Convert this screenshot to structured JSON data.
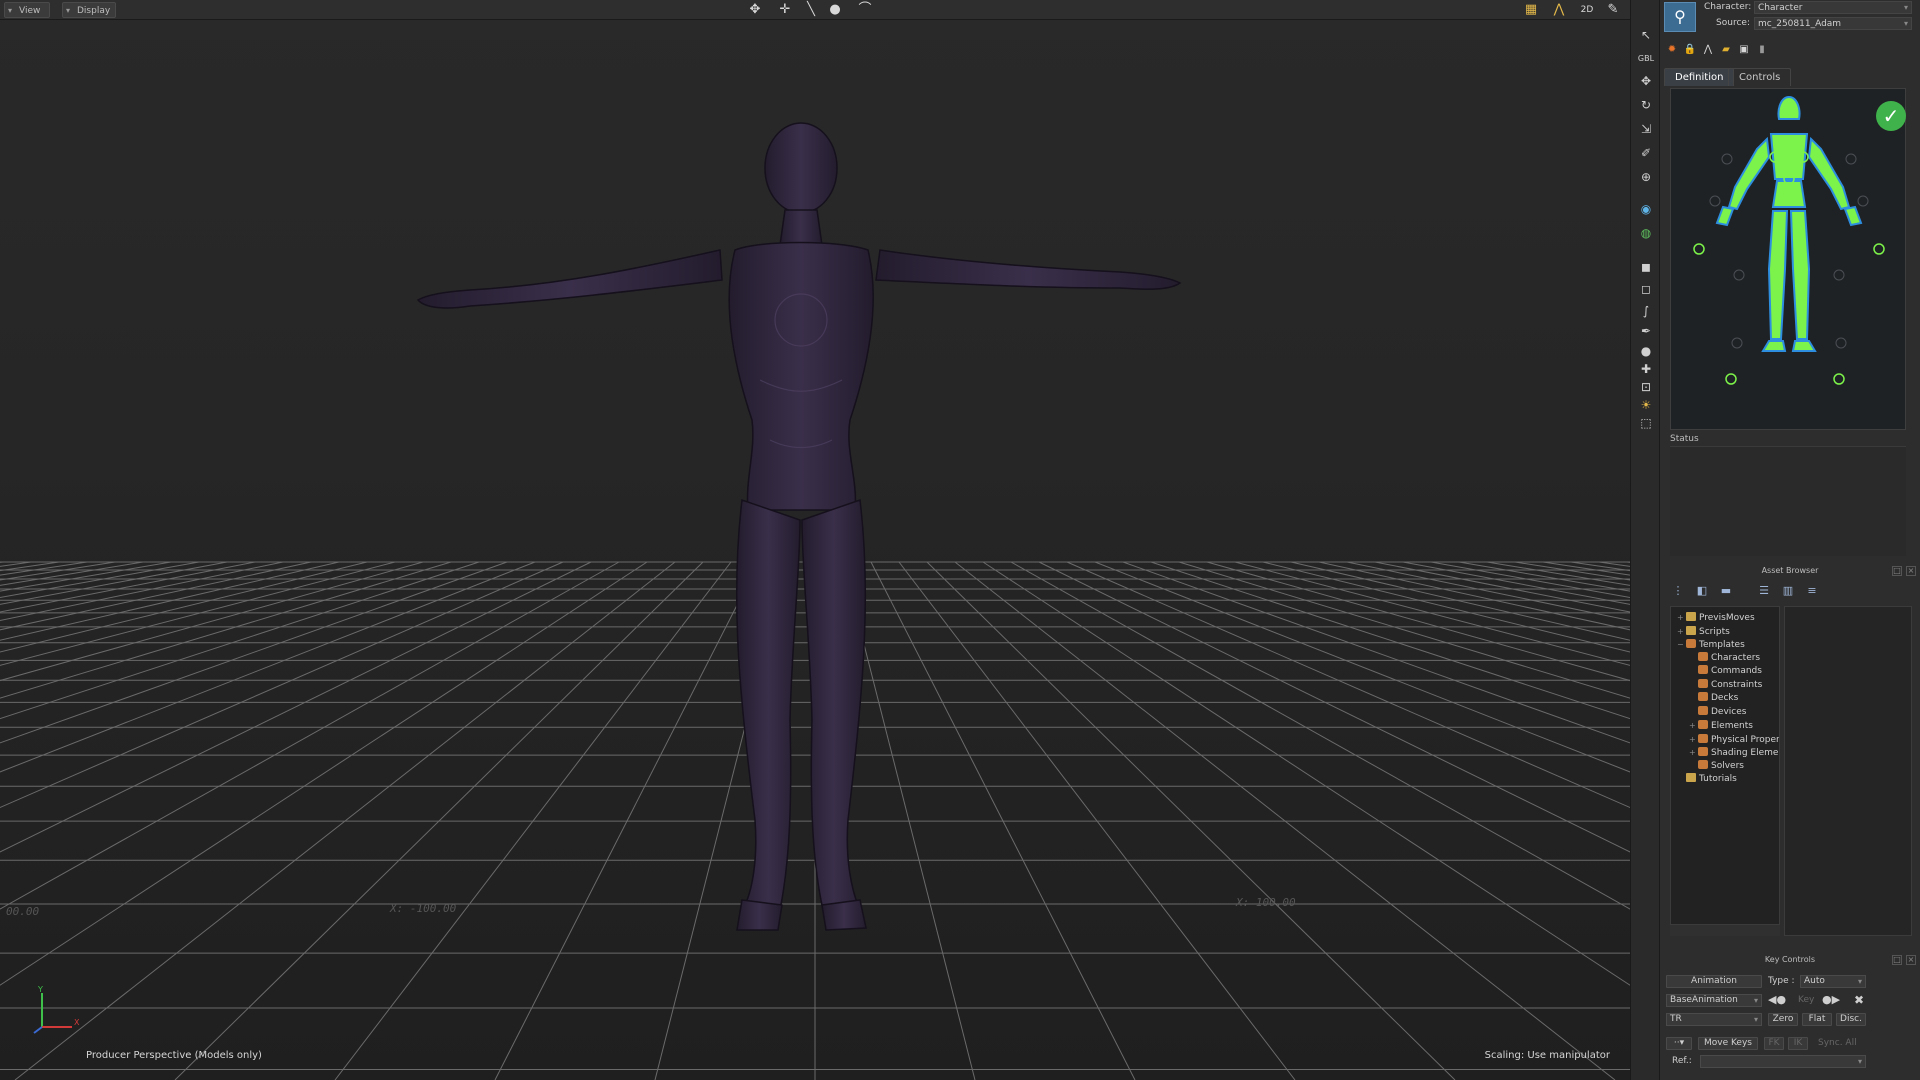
{
  "viewport": {
    "menus": [
      "View",
      "Display"
    ],
    "status_left": "Producer Perspective (Models only)",
    "status_right": "Scaling: Use manipulator",
    "grid_labels": [
      "00.00",
      "X: -100.00",
      "X: 100.00"
    ],
    "axis": {
      "x": "X",
      "y": "Y"
    }
  },
  "character": {
    "character_label": "Character:",
    "character_value": "Character",
    "source_label": "Source:",
    "source_value": "mc_250811_Adam",
    "tabs": [
      "Definition",
      "Controls"
    ],
    "status_label": "Status"
  },
  "asset_browser": {
    "title": "Asset Browser",
    "tree": [
      {
        "label": "PrevisMoves",
        "depth": 0,
        "icon": "folder",
        "toggle": "+"
      },
      {
        "label": "Scripts",
        "depth": 0,
        "icon": "folder",
        "toggle": "+"
      },
      {
        "label": "Templates",
        "depth": 0,
        "icon": "template",
        "toggle": "−"
      },
      {
        "label": "Characters",
        "depth": 1,
        "icon": "template",
        "toggle": ""
      },
      {
        "label": "Commands",
        "depth": 1,
        "icon": "template",
        "toggle": ""
      },
      {
        "label": "Constraints",
        "depth": 1,
        "icon": "template",
        "toggle": ""
      },
      {
        "label": "Decks",
        "depth": 1,
        "icon": "template",
        "toggle": ""
      },
      {
        "label": "Devices",
        "depth": 1,
        "icon": "template",
        "toggle": ""
      },
      {
        "label": "Elements",
        "depth": 1,
        "icon": "template",
        "toggle": "+"
      },
      {
        "label": "Physical Proper",
        "depth": 1,
        "icon": "template",
        "toggle": "+"
      },
      {
        "label": "Shading Elemen",
        "depth": 1,
        "icon": "template",
        "toggle": "+"
      },
      {
        "label": "Solvers",
        "depth": 1,
        "icon": "template",
        "toggle": ""
      },
      {
        "label": "Tutorials",
        "depth": 0,
        "icon": "folder",
        "toggle": ""
      }
    ]
  },
  "key_controls": {
    "title": "Key Controls",
    "animation_button": "Animation",
    "type_label": "Type :",
    "type_value": "Auto",
    "layer_value": "BaseAnimation",
    "key_label": "Key",
    "filter_value": "TR",
    "zero_button": "Zero",
    "flat_button": "Flat",
    "disc_button": "Disc.",
    "move_keys_button": "Move Keys",
    "fk_button": "FK",
    "ik_button": "IK",
    "sync_label": "Sync. All",
    "ref_label": "Ref.:"
  },
  "colors": {
    "accent_green": "#3fb24b",
    "figure": "#2c2338",
    "rig_green": "#7cf34a",
    "rig_blue": "#2d8ee0"
  }
}
